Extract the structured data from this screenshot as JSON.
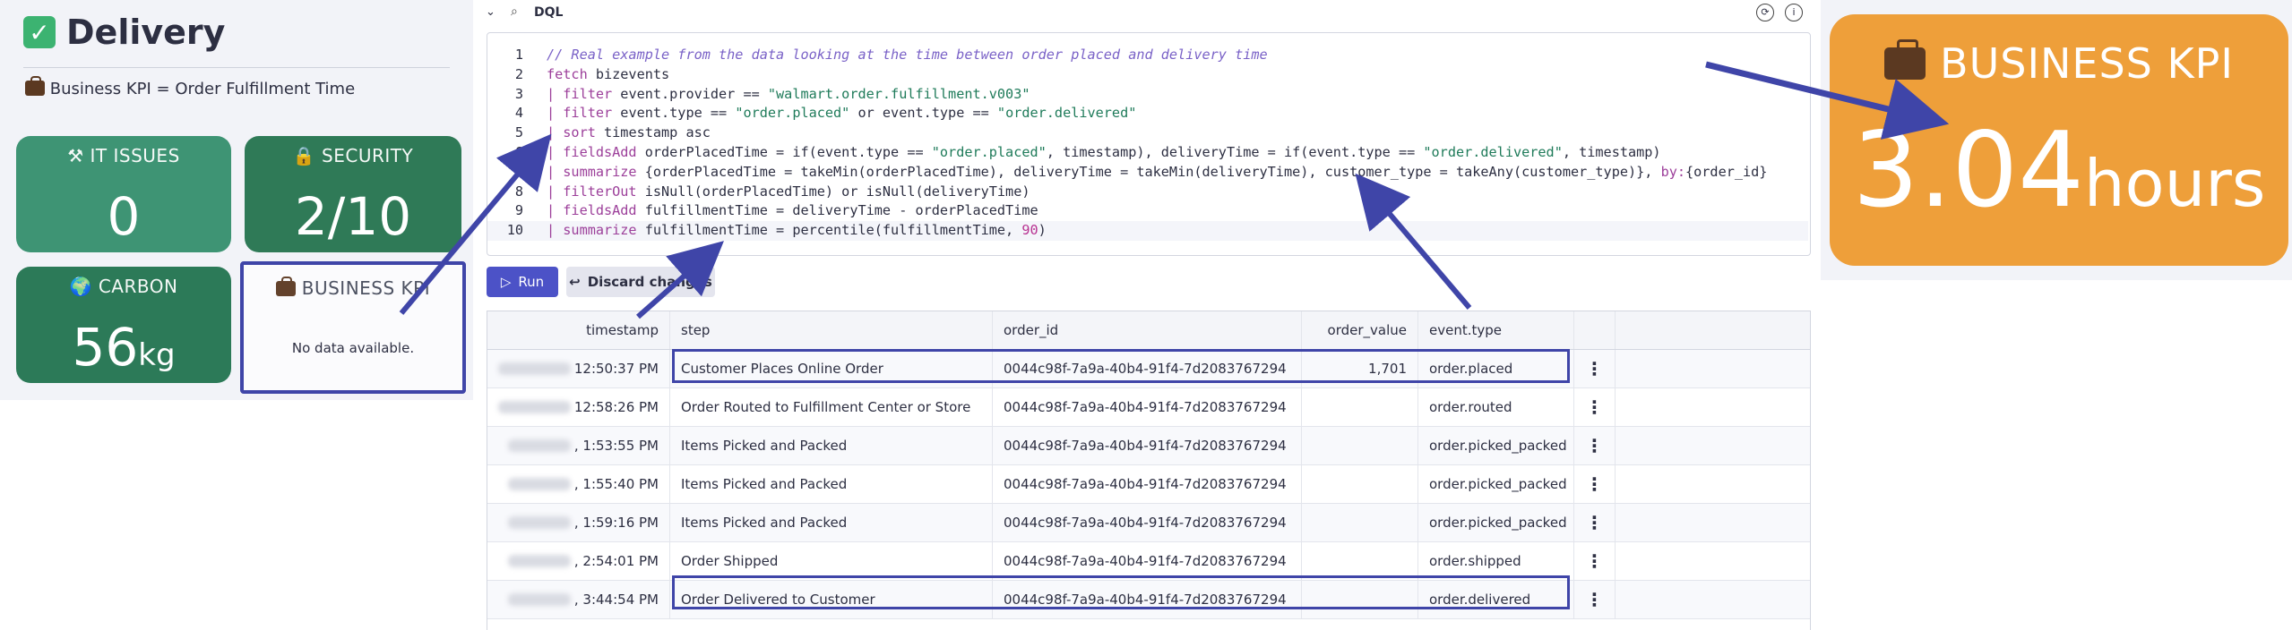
{
  "dashboard": {
    "title": "Delivery",
    "subtitle": "Business KPI = Order Fulfillment Time",
    "tiles": {
      "it": {
        "label": "IT ISSUES",
        "value": "0"
      },
      "security": {
        "label": "SECURITY",
        "value": "2/10"
      },
      "carbon": {
        "label": "CARBON",
        "value": "56",
        "unit": "kg"
      },
      "business": {
        "label": "BUSINESS KPI",
        "empty_text": "No data available."
      }
    }
  },
  "dql": {
    "section_label": "DQL",
    "run_label": "Run",
    "discard_label": "Discard changes",
    "line_numbers": [
      "1",
      "2",
      "3",
      "4",
      "5",
      "6",
      "7",
      "8",
      "9",
      "10"
    ]
  },
  "table": {
    "columns": [
      "timestamp",
      "step",
      "order_id",
      "order_value",
      "event.type"
    ],
    "rows": [
      {
        "timestamp": "12:50:37 PM",
        "step": "Customer Places Online Order",
        "order_id": "0044c98f-7a9a-40b4-91f4-7d2083767294",
        "order_value": "1,701",
        "event_type": "order.placed"
      },
      {
        "timestamp": "12:58:26 PM",
        "step": "Order Routed to Fulfillment Center or Store",
        "order_id": "0044c98f-7a9a-40b4-91f4-7d2083767294",
        "order_value": "",
        "event_type": "order.routed"
      },
      {
        "timestamp": ", 1:53:55 PM",
        "step": "Items Picked and Packed",
        "order_id": "0044c98f-7a9a-40b4-91f4-7d2083767294",
        "order_value": "",
        "event_type": "order.picked_packed"
      },
      {
        "timestamp": ", 1:55:40 PM",
        "step": "Items Picked and Packed",
        "order_id": "0044c98f-7a9a-40b4-91f4-7d2083767294",
        "order_value": "",
        "event_type": "order.picked_packed"
      },
      {
        "timestamp": ", 1:59:16 PM",
        "step": "Items Picked and Packed",
        "order_id": "0044c98f-7a9a-40b4-91f4-7d2083767294",
        "order_value": "",
        "event_type": "order.picked_packed"
      },
      {
        "timestamp": ", 2:54:01 PM",
        "step": "Order Shipped",
        "order_id": "0044c98f-7a9a-40b4-91f4-7d2083767294",
        "order_value": "",
        "event_type": "order.shipped"
      },
      {
        "timestamp": ", 3:44:54 PM",
        "step": "Order Delivered to Customer",
        "order_id": "0044c98f-7a9a-40b4-91f4-7d2083767294",
        "order_value": "",
        "event_type": "order.delivered"
      }
    ]
  },
  "kpi": {
    "label": "BUSINESS KPI",
    "value": "3.04",
    "unit": "hours"
  },
  "colors": {
    "accent": "#4c52c7",
    "highlight_box": "#3f45a8",
    "kpi_orange": "#ee9f3a",
    "tile_green": "#3e9474"
  }
}
